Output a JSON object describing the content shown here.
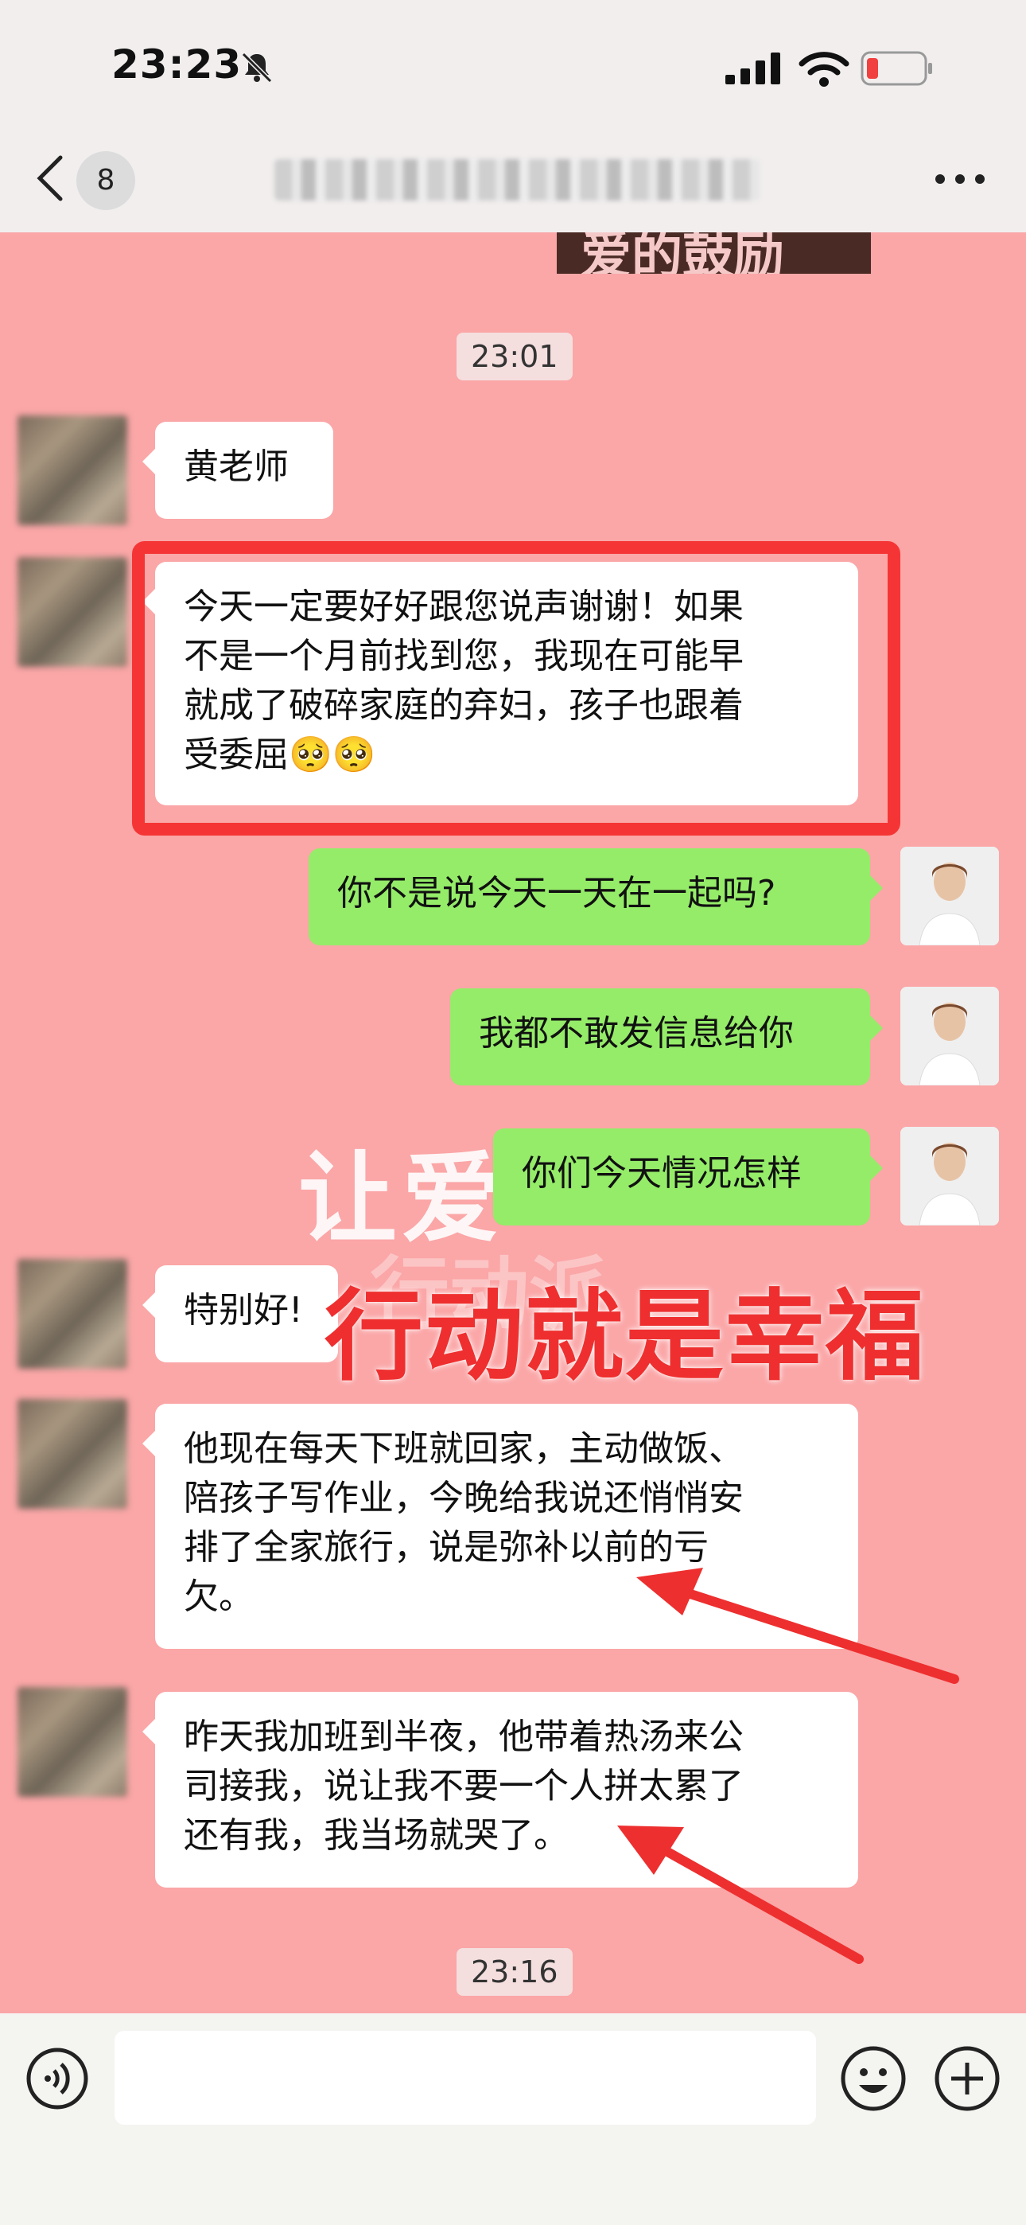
{
  "status_bar": {
    "time": "23:23",
    "bell_icon": "bell-slash-icon",
    "signal_icon": "signal-icon",
    "wifi_icon": "wifi-icon",
    "battery_icon": "battery-low-icon"
  },
  "header": {
    "back_icon": "chevron-left-icon",
    "unread_count": "8",
    "more_icon": "more-dots-icon"
  },
  "sticker_text": "爱的鼓励",
  "timestamps": [
    "23:01",
    "23:16"
  ],
  "messages": [
    {
      "side": "left",
      "text": "黄老师"
    },
    {
      "side": "left",
      "lines": [
        "今天一定要好好跟您说声谢谢！如果",
        "不是一个月前找到您，我现在可能早",
        "就成了破碎家庭的弃妇，孩子也跟着",
        "受委屈🥺🥺"
      ]
    },
    {
      "side": "right",
      "text": "你不是说今天一天在一起吗?"
    },
    {
      "side": "right",
      "text": "我都不敢发信息给你"
    },
    {
      "side": "right",
      "text": "你们今天情况怎样"
    },
    {
      "side": "left",
      "text": "特别好!"
    },
    {
      "side": "left",
      "lines": [
        "他现在每天下班就回家，主动做饭、",
        "陪孩子写作业，今晚给我说还悄悄安",
        "排了全家旅行，说是弥补以前的亏",
        "欠。"
      ]
    },
    {
      "side": "left",
      "lines": [
        "昨天我加班到半夜，他带着热汤来公",
        "司接我，说让我不要一个人拼太累了",
        "还有我，我当场就哭了。"
      ]
    }
  ],
  "overlay": {
    "watermark": "让爱",
    "watermark_2": "行动派",
    "headline": "行动就是幸福",
    "accent_color": "#ef2f2f"
  },
  "input_bar": {
    "voice_icon": "voice-icon",
    "emoji_icon": "emoji-icon",
    "plus_icon": "plus-icon"
  },
  "colors": {
    "chat_bg": "#fba6a7",
    "sent_bubble": "#95ec69",
    "received_bubble": "#ffffff",
    "highlight_box": "#f53535"
  }
}
